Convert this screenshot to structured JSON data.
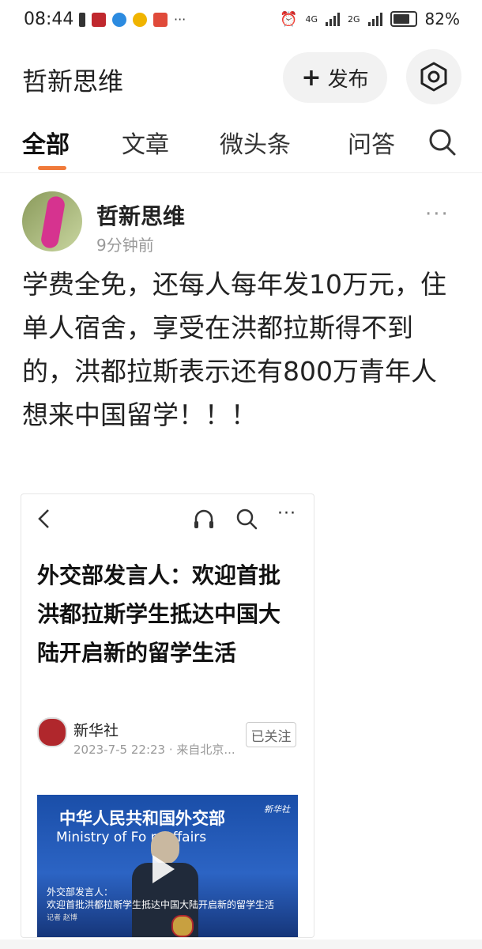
{
  "status_bar": {
    "time": "08:44",
    "network_1": "4G",
    "network_2": "2G",
    "battery": "82%"
  },
  "header": {
    "title": "哲新思维",
    "publish_label": "发布",
    "publish_icon": "plus-icon",
    "settings_icon": "hexagon-settings-icon"
  },
  "tabs": [
    {
      "label": "全部",
      "active": true
    },
    {
      "label": "文章"
    },
    {
      "label": "微头条"
    },
    {
      "label": "问答"
    }
  ],
  "post": {
    "author": "哲新思维",
    "time_ago": "9分钟前",
    "more": "···",
    "text": "学费全免，还每人每年发10万元，住单人宿舍，享受在洪都拉斯得不到的，洪都拉斯表示还有800万青年人想来中国留学！！！",
    "embedded": {
      "title": "外交部发言人：欢迎首批洪都拉斯学生抵达中国大陆开启新的留学生活",
      "source_name": "新华社",
      "source_meta": "2023-7-5 22:23 · 来自北京...",
      "follow_label": "已关注",
      "more": "···",
      "video": {
        "banner_cn": "中华人民共和国外交部",
        "banner_en": "Ministry of Fo    n Affairs",
        "brand": "新华社",
        "caption_1": "外交部发言人：",
        "caption_2": "欢迎首批洪都拉斯学生抵达中国大陆开启新的留学生活",
        "caption_3": "记者 赵博"
      }
    }
  },
  "colors": {
    "accent": "#f07a3a",
    "text": "#222222",
    "muted": "#999999"
  }
}
